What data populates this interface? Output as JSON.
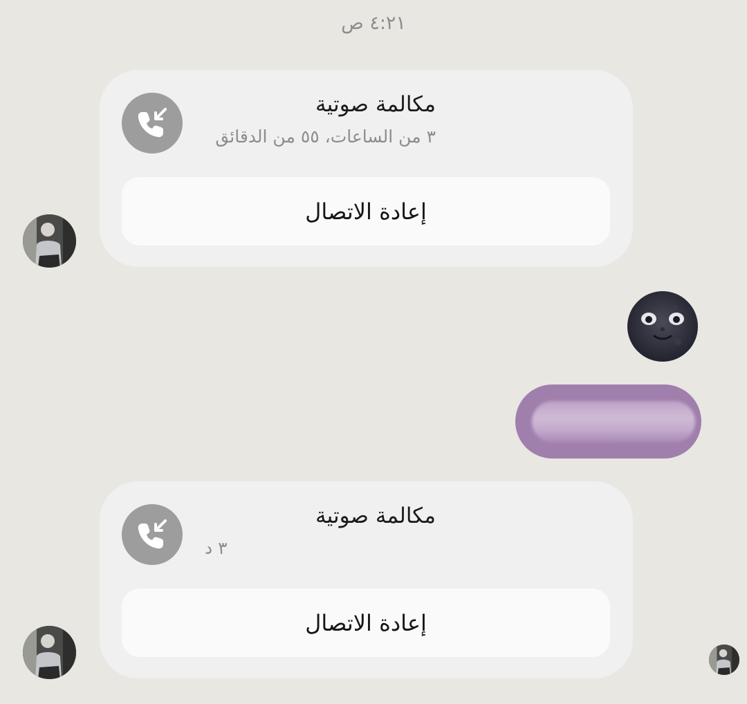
{
  "timestamp": "٤:٢١ ص",
  "calls": [
    {
      "title": "مكالمة صوتية",
      "duration": "٣ من الساعات، ٥٥ من الدقائق",
      "callback_label": "إعادة الاتصال"
    },
    {
      "title": "مكالمة صوتية",
      "duration": "٣ د",
      "callback_label": "إعادة الاتصال"
    }
  ],
  "sent": {
    "emoji": "new-moon-face",
    "message_text_visible": false
  },
  "colors": {
    "background": "#e8e7e2",
    "card": "#f0f0f0",
    "button": "#fafafa",
    "call_icon_bg": "#9d9d9d",
    "sent_bubble": "#a07fad"
  },
  "icons": {
    "call": "incoming-call-icon",
    "avatar": "contact-avatar"
  }
}
